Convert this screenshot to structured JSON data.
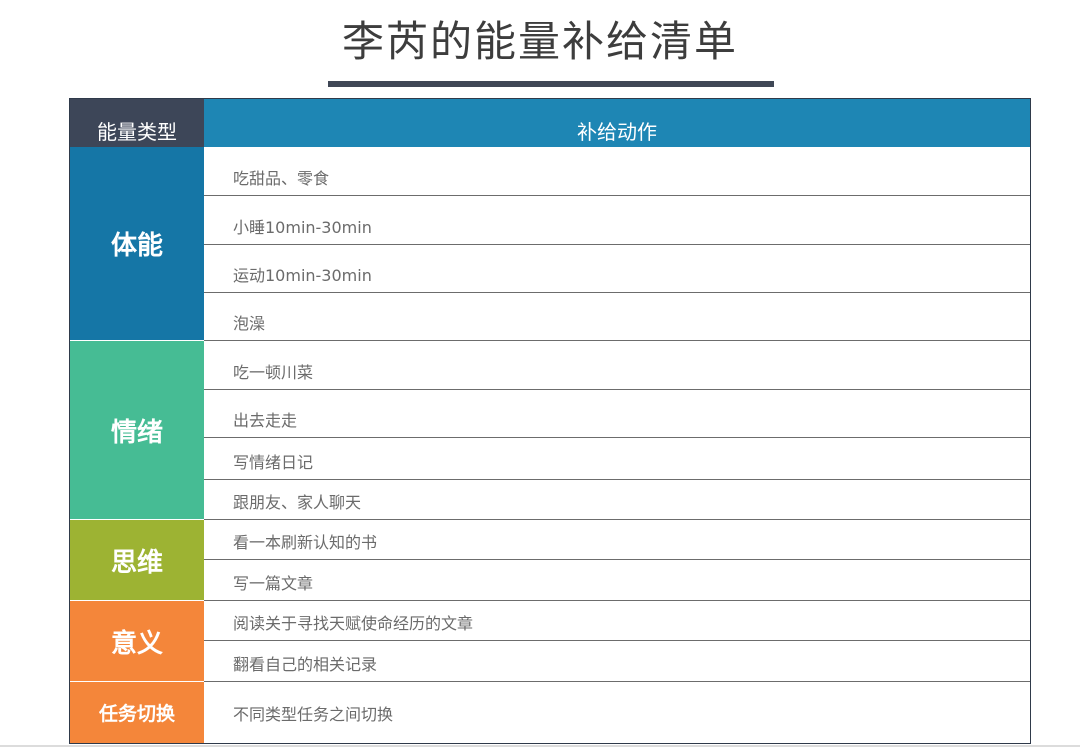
{
  "title": "李芮的能量补给清单",
  "header": {
    "type_label": "能量类型",
    "action_label": "补给动作"
  },
  "colors": {
    "physical": "#1576a6",
    "emotion": "#46bc94",
    "thinking": "#9db333",
    "meaning": "#f4863a",
    "switch": "#f4863a",
    "header_dark": "#3d4658",
    "header_blue": "#1e86b4"
  },
  "categories": [
    {
      "name": "体能",
      "actions": [
        "吃甜品、零食",
        "小睡10min-30min",
        "运动10min-30min",
        "泡澡"
      ]
    },
    {
      "name": "情绪",
      "actions": [
        "吃一顿川菜",
        "出去走走",
        "写情绪日记",
        "跟朋友、家人聊天"
      ]
    },
    {
      "name": "思维",
      "actions": [
        "看一本刷新认知的书",
        "写一篇文章"
      ]
    },
    {
      "name": "意义",
      "actions": [
        "阅读关于寻找天赋使命经历的文章",
        "翻看自己的相关记录"
      ]
    },
    {
      "name": "任务切换",
      "actions": [
        "不同类型任务之间切换"
      ]
    }
  ]
}
